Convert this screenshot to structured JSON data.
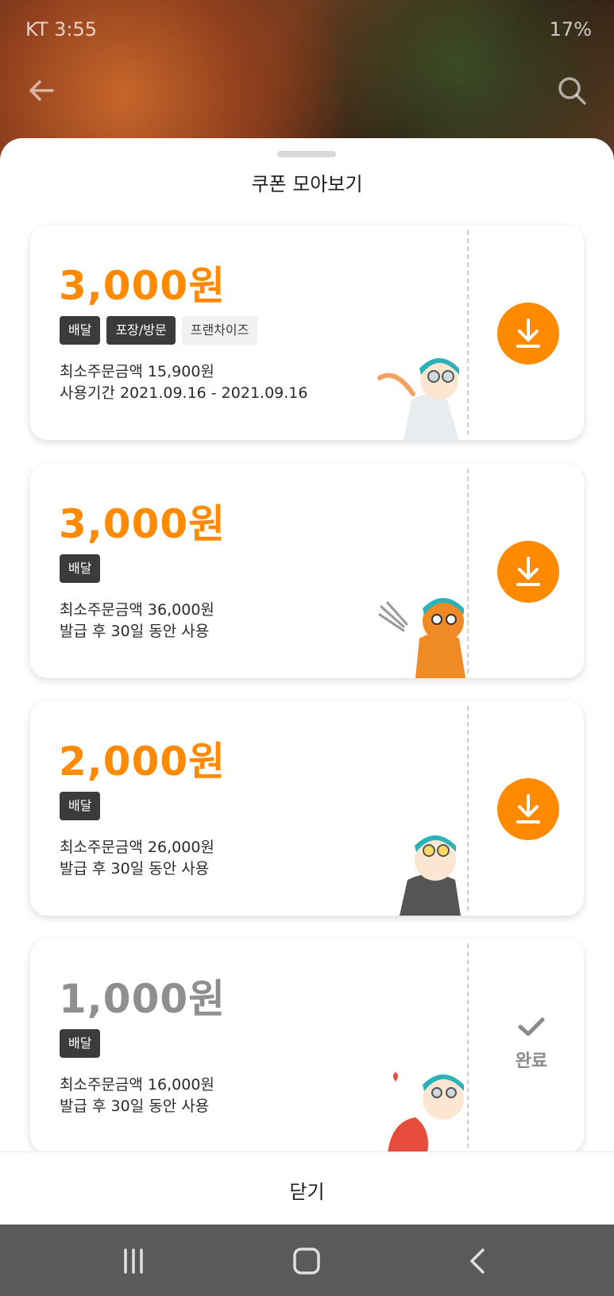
{
  "status_bar": {
    "carrier_time": "KT 3:55",
    "battery": "17%"
  },
  "sheet": {
    "title": "쿠폰 모아보기",
    "close_label": "닫기"
  },
  "coupons": [
    {
      "amount": "3,000원",
      "tags": [
        "배달",
        "포장/방문",
        "프랜차이즈"
      ],
      "min_order": "최소주문금액 15,900원",
      "period": "사용기간 2021.09.16 - 2021.09.16",
      "action": "download"
    },
    {
      "amount": "3,000원",
      "tags": [
        "배달"
      ],
      "min_order": "최소주문금액 36,000원",
      "period": "발급 후 30일 동안 사용",
      "action": "download"
    },
    {
      "amount": "2,000원",
      "tags": [
        "배달"
      ],
      "min_order": "최소주문금액 26,000원",
      "period": "발급 후 30일 동안 사용",
      "action": "download"
    },
    {
      "amount": "1,000원",
      "tags": [
        "배달"
      ],
      "min_order": "최소주문금액 16,000원",
      "period": "발급 후 30일 동안 사용",
      "action": "done",
      "done_label": "완료"
    }
  ],
  "colors": {
    "accent": "#ff8a00",
    "tag_dark": "#3b3b3b",
    "tag_light": "#f1f1f1",
    "done_gray": "#8f8f8f",
    "nav_bar": "#5a5a5a"
  },
  "icons": {
    "back": "arrow-left-icon",
    "search": "search-icon",
    "download": "download-icon",
    "done": "check-icon",
    "nav_recents": "recents-icon",
    "nav_home": "home-icon",
    "nav_back": "chevron-left-icon"
  }
}
